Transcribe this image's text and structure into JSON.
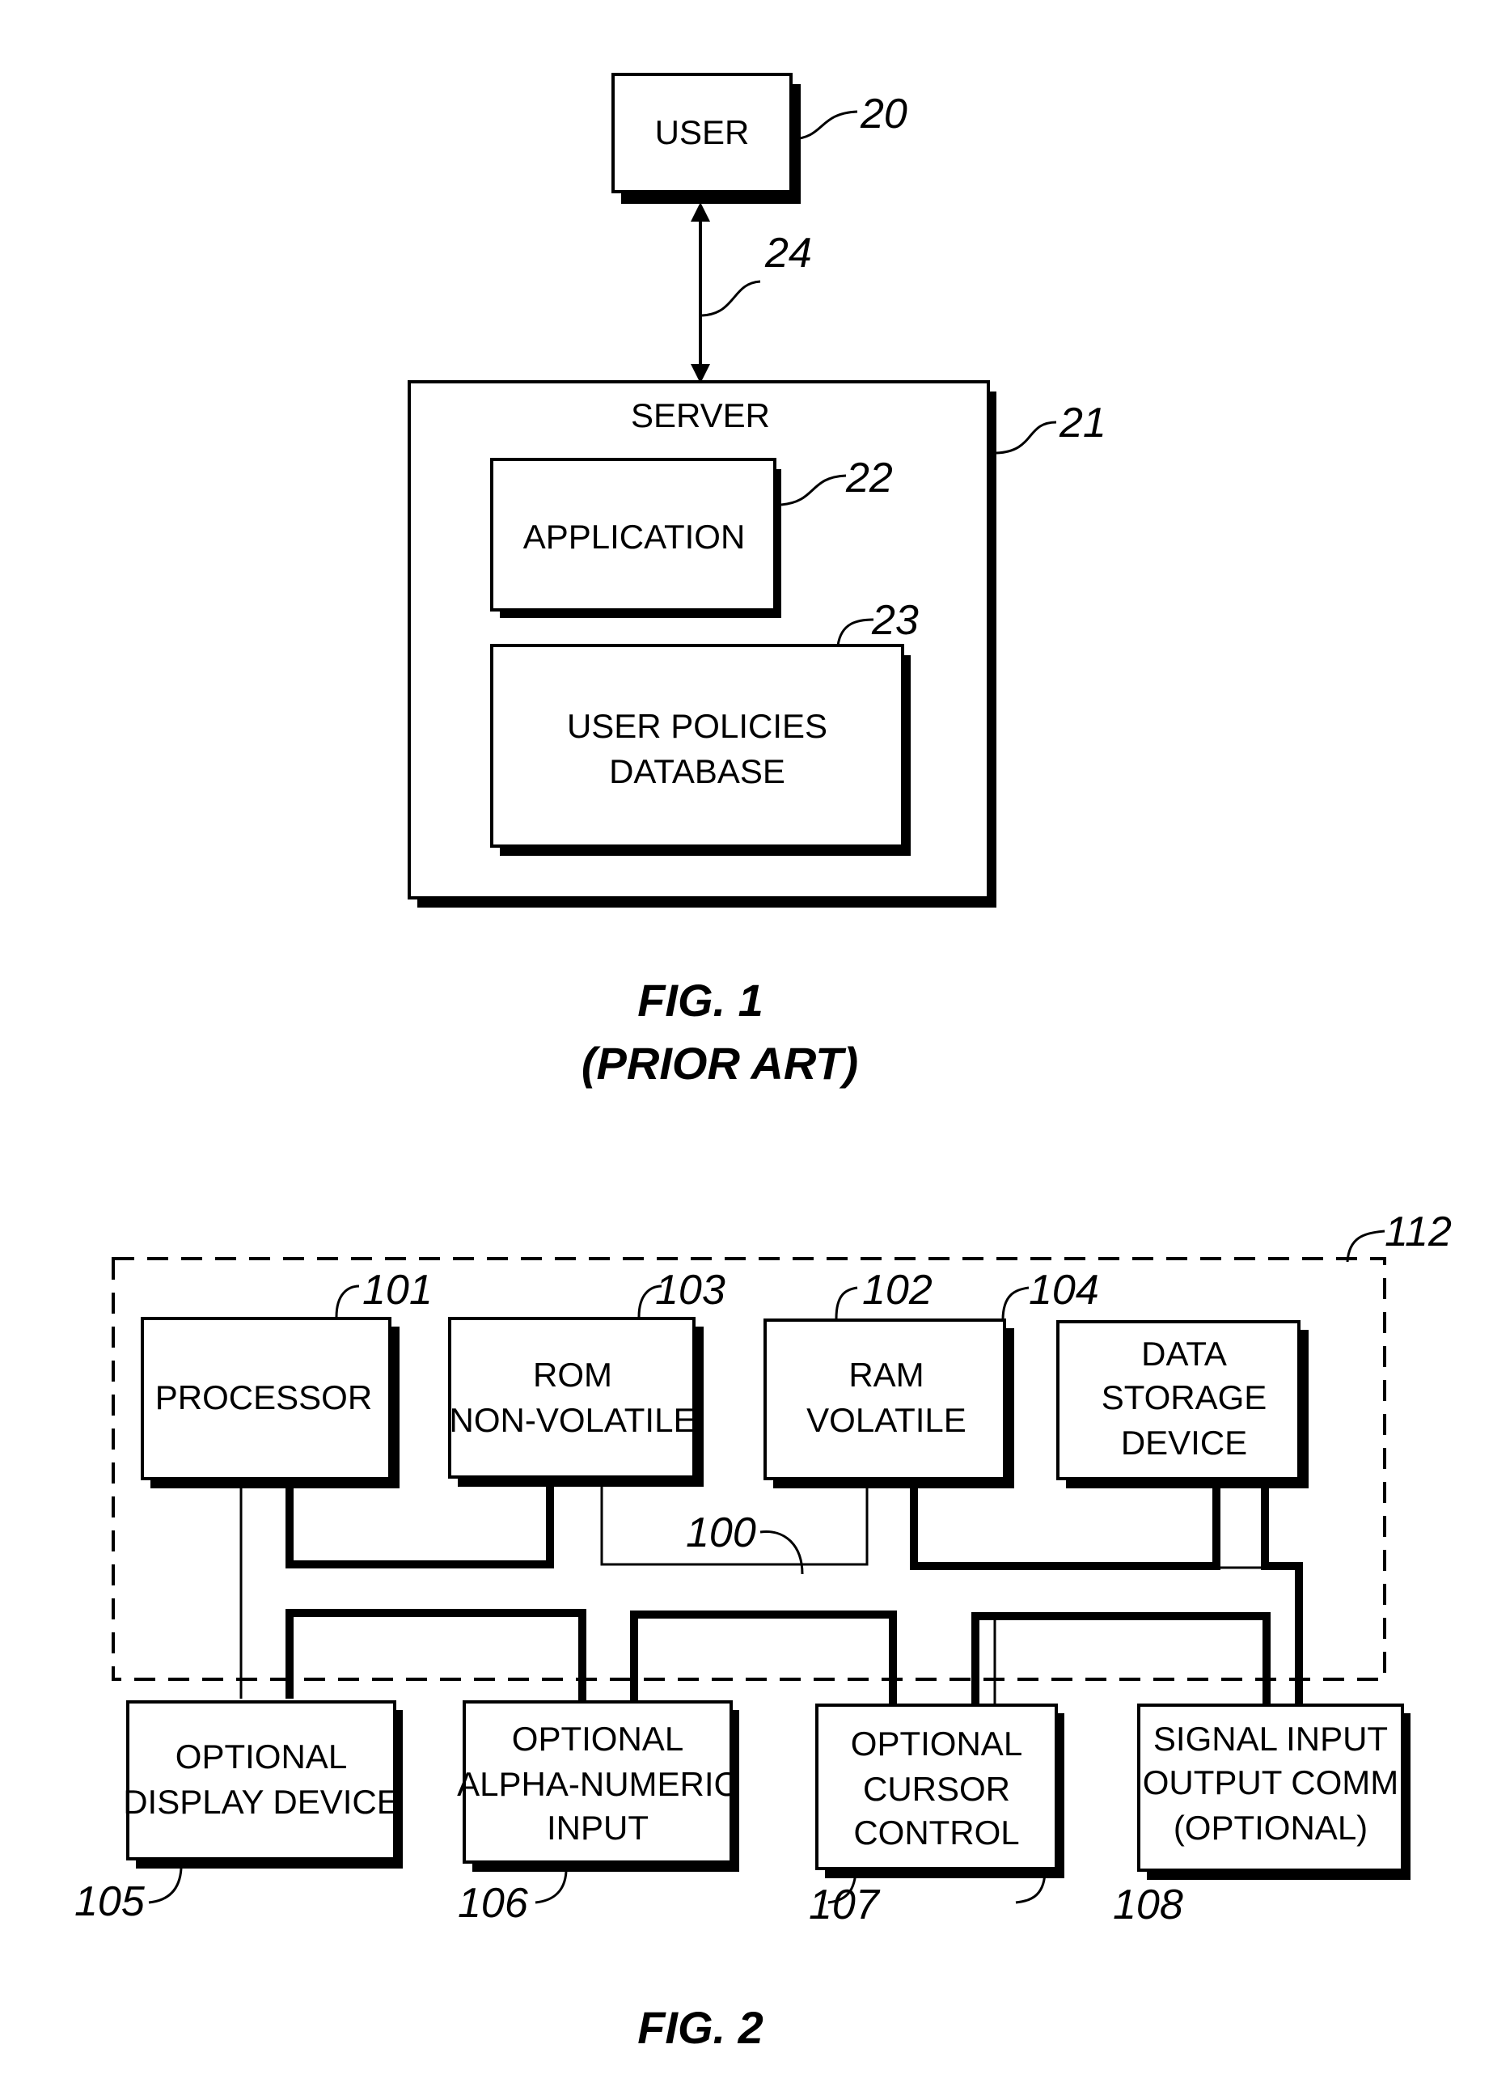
{
  "fig1": {
    "caption": "FIG. 1",
    "subcaption": "(PRIOR ART)",
    "user": {
      "label": "USER",
      "ref": "20"
    },
    "link": {
      "ref": "24"
    },
    "server": {
      "label": "SERVER",
      "ref": "21"
    },
    "application": {
      "label": "APPLICATION",
      "ref": "22"
    },
    "database": {
      "lines": [
        "USER POLICIES",
        "DATABASE"
      ],
      "ref": "23"
    }
  },
  "fig2": {
    "caption": "FIG. 2",
    "enclosure_ref": "112",
    "bus_ref": "100",
    "top_blocks": [
      {
        "lines": [
          "PROCESSOR"
        ],
        "ref": "101"
      },
      {
        "lines": [
          "ROM",
          "NON-VOLATILE"
        ],
        "ref": "103"
      },
      {
        "lines": [
          "RAM",
          "VOLATILE"
        ],
        "ref": "102"
      },
      {
        "lines": [
          "DATA",
          "STORAGE",
          "DEVICE"
        ],
        "ref": "104"
      }
    ],
    "bottom_blocks": [
      {
        "lines": [
          "OPTIONAL",
          "DISPLAY DEVICE"
        ],
        "ref": "105"
      },
      {
        "lines": [
          "OPTIONAL",
          "ALPHA-NUMERIC",
          "INPUT"
        ],
        "ref": "106"
      },
      {
        "lines": [
          "OPTIONAL",
          "CURSOR",
          "CONTROL"
        ],
        "ref": "107"
      },
      {
        "lines": [
          "SIGNAL INPUT",
          "OUTPUT COMM",
          "(OPTIONAL)"
        ],
        "ref": "108"
      }
    ]
  }
}
